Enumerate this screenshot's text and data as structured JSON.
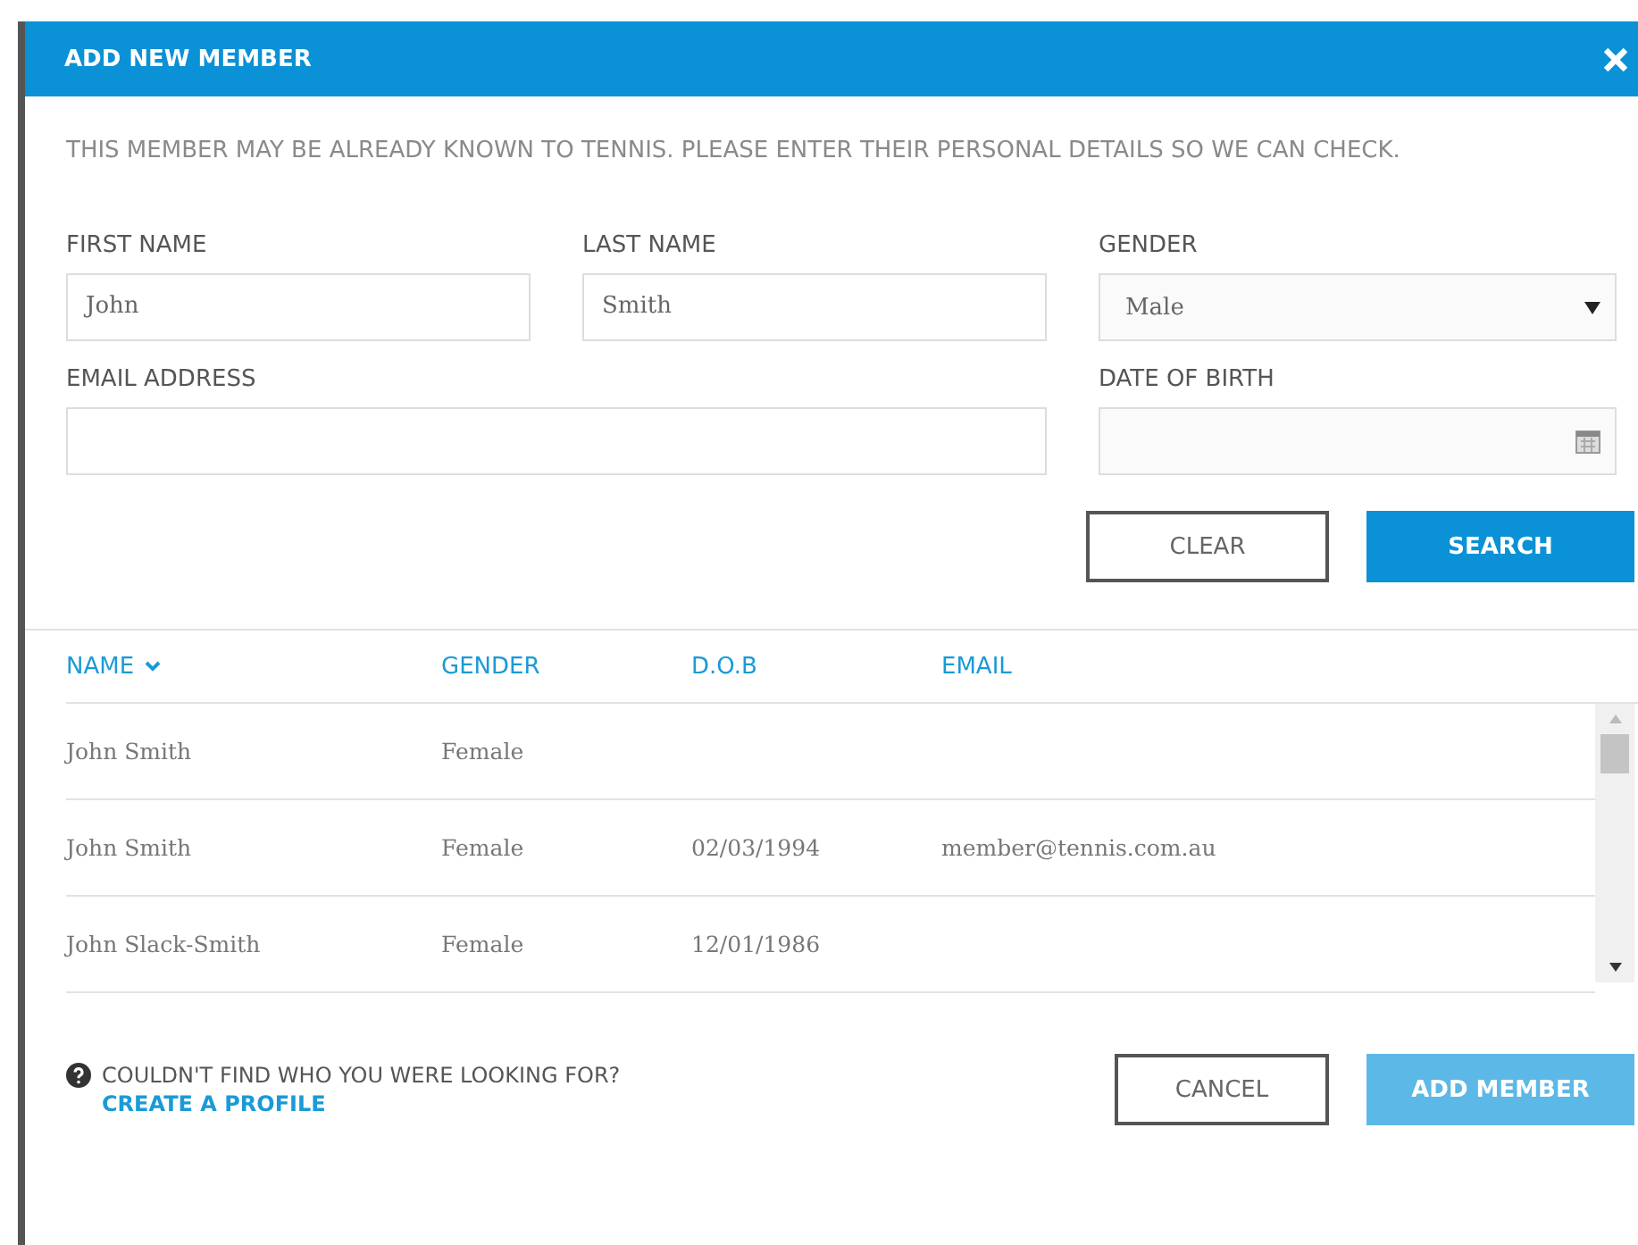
{
  "dialog": {
    "title": "ADD NEW MEMBER"
  },
  "intro": "THIS MEMBER MAY BE ALREADY KNOWN TO TENNIS. PLEASE ENTER THEIR PERSONAL DETAILS SO WE CAN CHECK.",
  "fields": [
    {
      "kind": "text",
      "label": "FIRST NAME",
      "value": "John"
    },
    {
      "kind": "text",
      "label": "LAST NAME",
      "value": "Smith"
    },
    {
      "kind": "select",
      "label": "GENDER",
      "value": "Male"
    },
    {
      "kind": "text",
      "label": "EMAIL ADDRESS"
    },
    {
      "kind": "date",
      "label": "DATE OF BIRTH"
    }
  ],
  "search_buttons": [
    {
      "label": "CLEAR",
      "primary": false
    },
    {
      "label": "SEARCH",
      "primary": true
    }
  ],
  "table": {
    "columns": [
      {
        "label": "NAME",
        "sorted": true
      },
      {
        "label": "GENDER",
        "sorted": false
      },
      {
        "label": "D.O.B",
        "sorted": false
      },
      {
        "label": "EMAIL",
        "sorted": false
      }
    ],
    "rows": [
      [
        "John Smith",
        "Female",
        "",
        ""
      ],
      [
        "John Smith",
        "Female",
        "02/03/1994",
        "member@tennis.com.au"
      ],
      [
        "John Slack-Smith",
        "Female",
        "12/01/1986",
        ""
      ]
    ]
  },
  "footer": {
    "question": "COULDN'T FIND WHO YOU WERE LOOKING FOR?",
    "link": "CREATE A PROFILE",
    "buttons": [
      {
        "label": "CANCEL",
        "primary": false,
        "disabled": false
      },
      {
        "label": "ADD MEMBER",
        "primary": true,
        "disabled": true
      }
    ]
  }
}
